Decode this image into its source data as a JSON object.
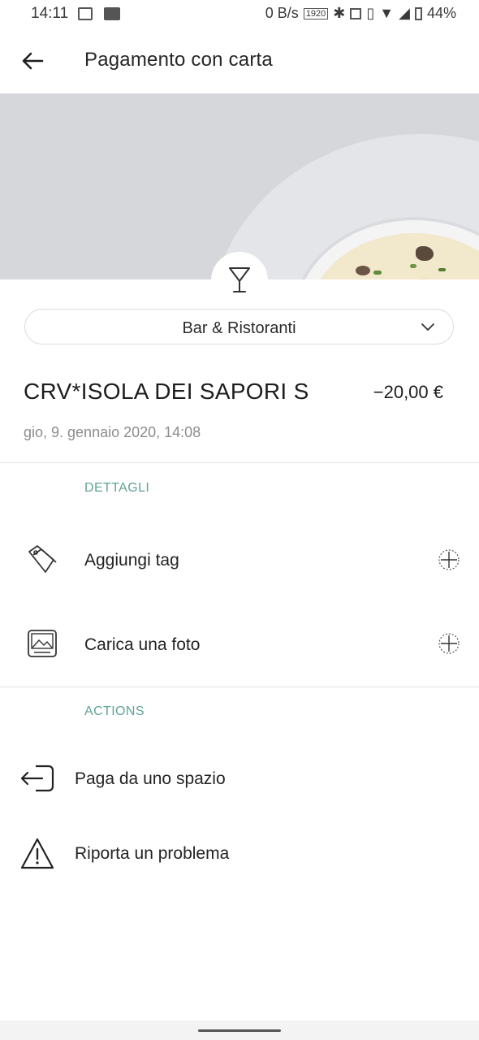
{
  "status_bar": {
    "time": "14:11",
    "net_speed": "0 B/s",
    "battery": "44%"
  },
  "header": {
    "title": "Pagamento con carta"
  },
  "category": {
    "label": "Bar & Ristoranti",
    "icon": "cocktail-glass-icon"
  },
  "transaction": {
    "merchant": "CRV*ISOLA DEI SAPORI S",
    "amount": "−20,00 €",
    "date": "gio, 9. gennaio 2020, 14:08"
  },
  "details": {
    "section_label": "DETTAGLI",
    "items": [
      {
        "label": "Aggiungi tag",
        "icon": "tag-icon"
      },
      {
        "label": "Carica una foto",
        "icon": "image-icon"
      }
    ]
  },
  "actions": {
    "section_label": "ACTIONS",
    "items": [
      {
        "label": "Paga da uno spazio",
        "icon": "move-from-space-icon"
      },
      {
        "label": "Riporta un problema",
        "icon": "warning-icon"
      }
    ]
  },
  "colors": {
    "accent": "#5fa396",
    "hero_bg": "#d5d7da"
  }
}
